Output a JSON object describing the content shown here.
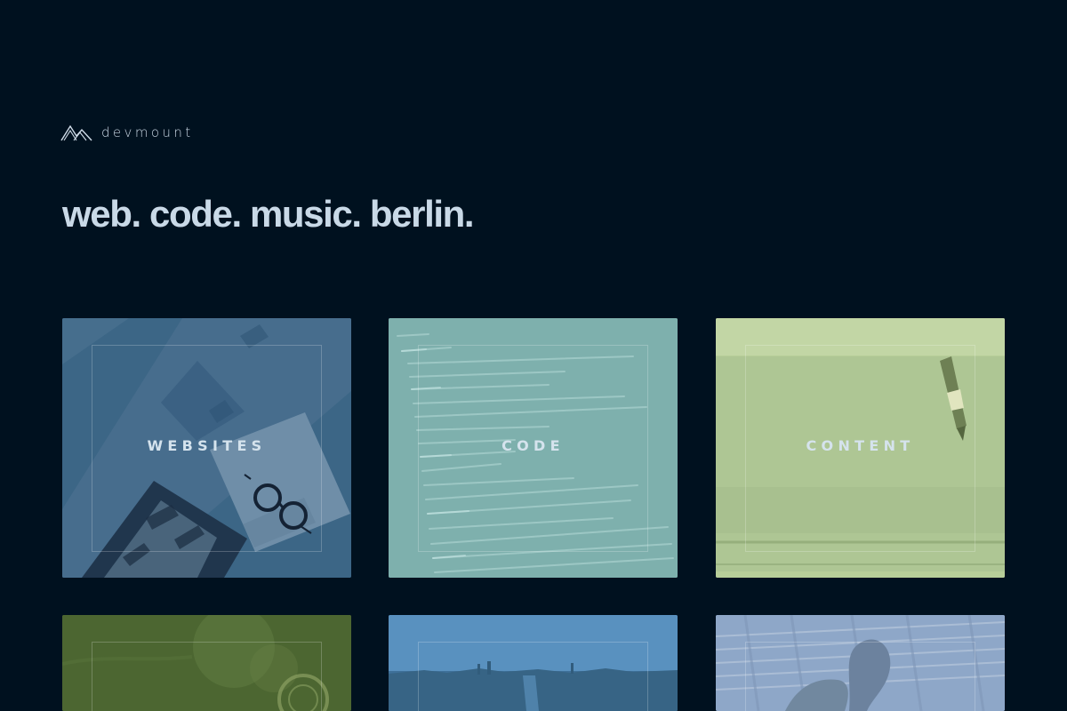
{
  "brand": {
    "name": "devmount",
    "logo_icon": "mountain-peaks-icon"
  },
  "hero": {
    "tagline": "web. code. music. berlin."
  },
  "tiles": [
    {
      "label": "WEBSITES",
      "tint": "#3c6686"
    },
    {
      "label": "CODE",
      "tint": "#7eb0ad"
    },
    {
      "label": "CONTENT",
      "tint": "#b7ce99"
    },
    {
      "label": "",
      "tint": "#4c6631"
    },
    {
      "label": "",
      "tint": "#5991bf"
    },
    {
      "label": "",
      "tint": "#8ea7c8"
    }
  ],
  "colors": {
    "background": "#00111f",
    "text": "#c9d9e7"
  }
}
